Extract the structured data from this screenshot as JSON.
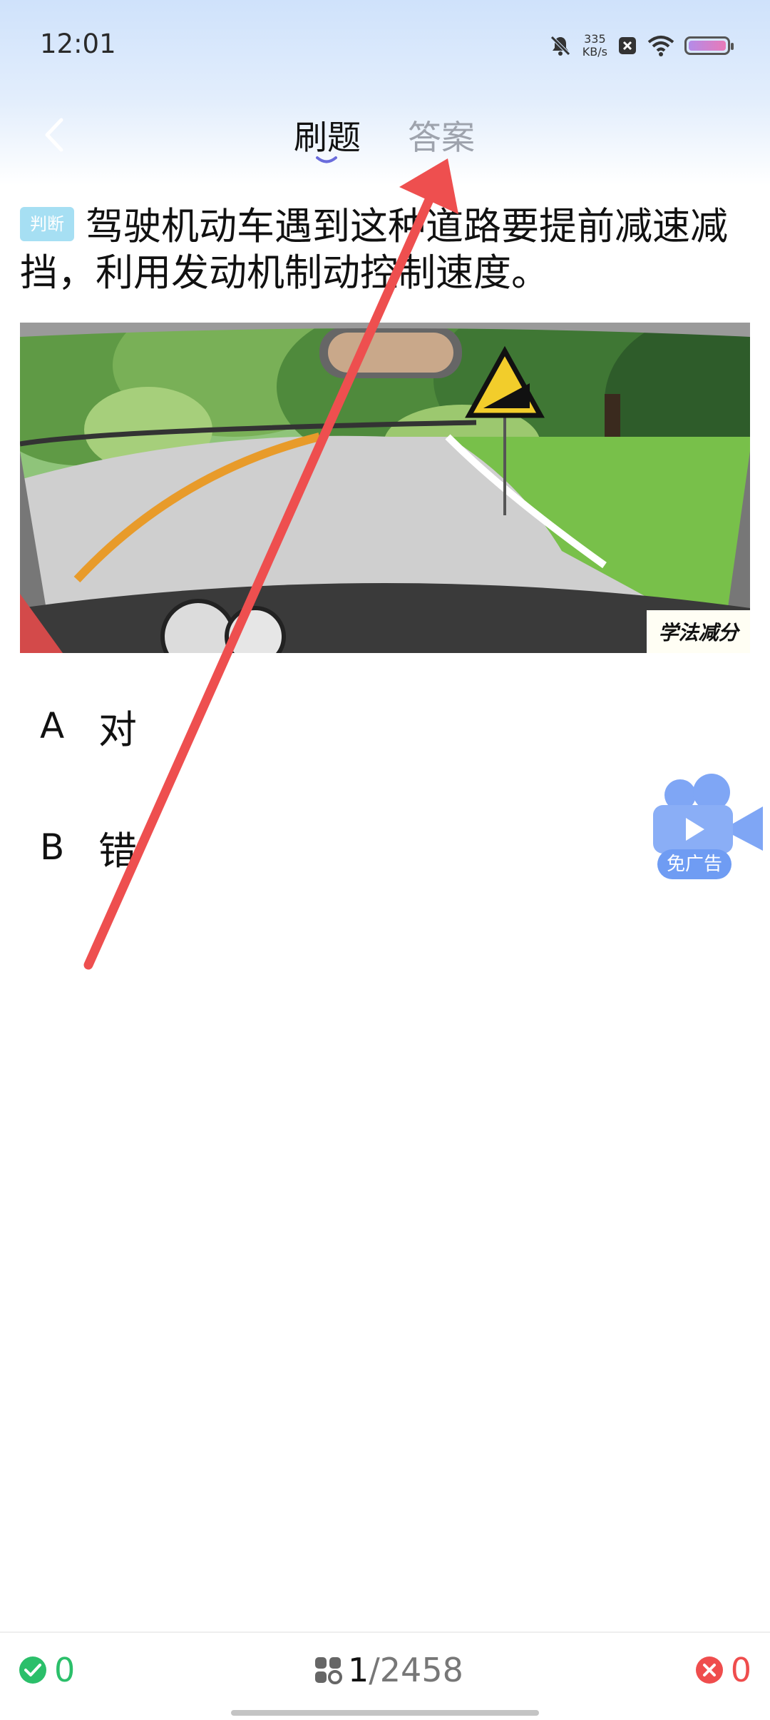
{
  "status_bar": {
    "time": "12:01",
    "net_speed_value": "335",
    "net_speed_unit": "KB/s",
    "icons": [
      "mute-bell-icon",
      "close-box-icon",
      "wifi-icon",
      "battery-icon"
    ]
  },
  "nav": {
    "tabs": [
      {
        "label": "刷题",
        "active": true
      },
      {
        "label": "答案",
        "active": false
      }
    ],
    "accent_color": "#6a6cdc"
  },
  "question": {
    "tag": "判断",
    "text": "驾驶机动车遇到这种道路要提前减速减挡，利用发动机制动控制速度。",
    "image_watermark": "学法减分"
  },
  "options": [
    {
      "letter": "A",
      "text": "对"
    },
    {
      "letter": "B",
      "text": "错"
    }
  ],
  "float_ad": {
    "label": "免广告",
    "icon": "video-camera-icon"
  },
  "bottom_bar": {
    "correct_count": "0",
    "current": "1",
    "total": "/2458",
    "wrong_count": "0",
    "colors": {
      "correct": "#2bbf6a",
      "wrong": "#ef4d4d"
    }
  }
}
